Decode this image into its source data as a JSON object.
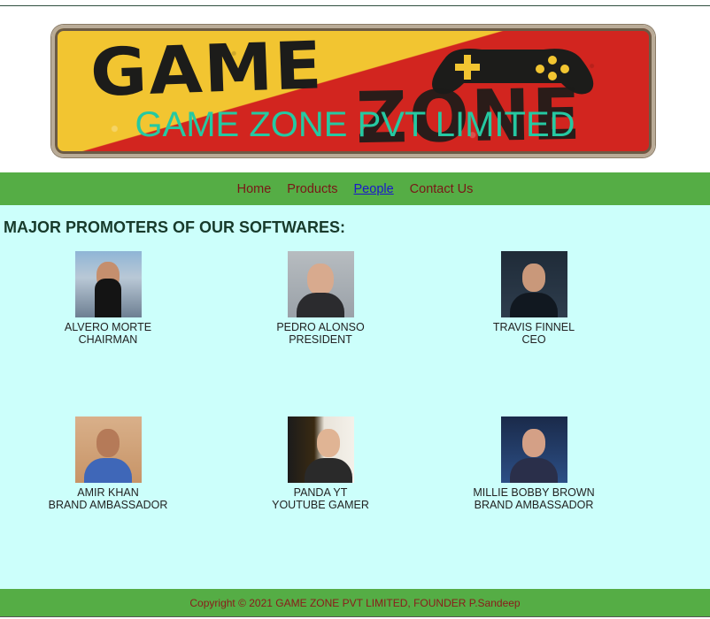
{
  "banner": {
    "logo_text": "GAME ZONE",
    "title": "GAME ZONE PVT LIMITED"
  },
  "nav": {
    "items": [
      {
        "label": "Home",
        "active": false
      },
      {
        "label": "Products",
        "active": false
      },
      {
        "label": "People",
        "active": true
      },
      {
        "label": "Contact Us",
        "active": false
      }
    ]
  },
  "main": {
    "heading": "MAJOR PROMOTERS OF OUR SOFTWARES:",
    "people": [
      {
        "name": "ALVERO MORTE",
        "role": "CHAIRMAN",
        "photo": "person-photo"
      },
      {
        "name": "PEDRO ALONSO",
        "role": "PRESIDENT",
        "photo": "person-photo"
      },
      {
        "name": "TRAVIS FINNEL",
        "role": "CEO",
        "photo": "person-photo"
      },
      {
        "name": "AMIR KHAN",
        "role": "BRAND AMBASSADOR",
        "photo": "person-photo"
      },
      {
        "name": "PANDA YT",
        "role": "YOUTUBE GAMER",
        "photo": "person-photo"
      },
      {
        "name": "MILLIE BOBBY BROWN",
        "role": "BRAND AMBASSADOR",
        "photo": "person-photo"
      }
    ]
  },
  "footer": {
    "text": "Copyright © 2021 GAME ZONE PVT LIMITED, FOUNDER P.Sandeep"
  },
  "colors": {
    "nav_bg": "#55ad45",
    "main_bg": "#ccfffb",
    "title_color": "#25c9a2",
    "link_color": "#7a1717",
    "active_link": "#1a18cc"
  }
}
